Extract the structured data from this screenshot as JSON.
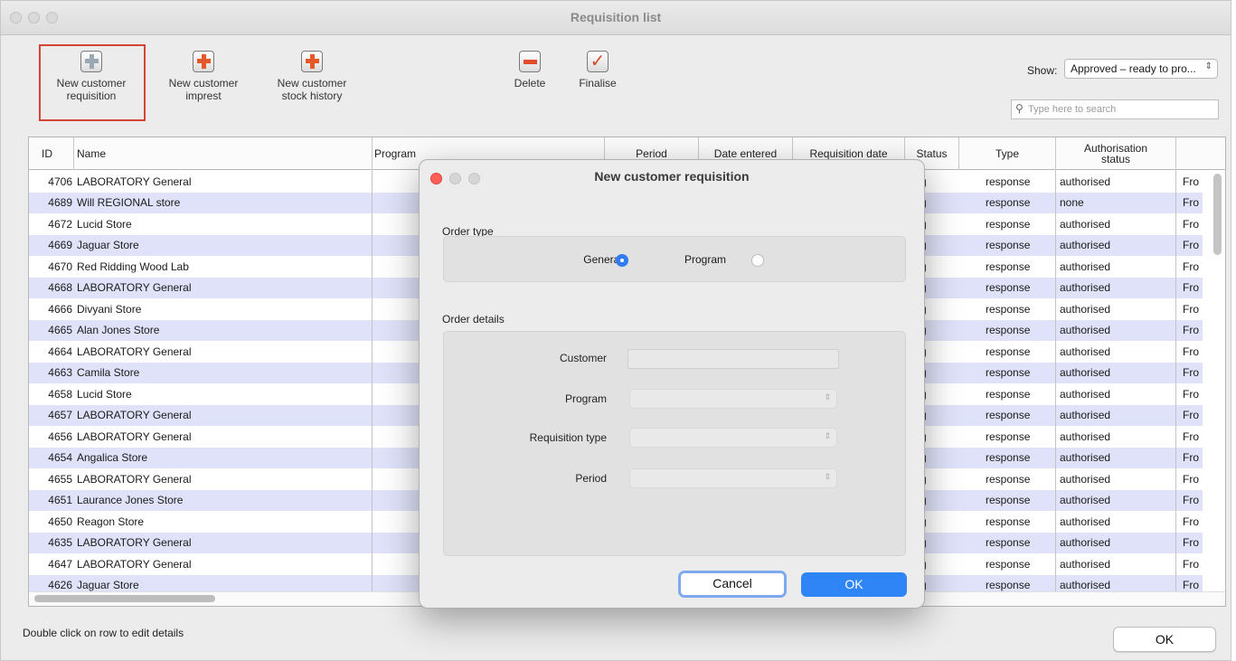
{
  "window": {
    "title": "Requisition list"
  },
  "toolbar": {
    "new_customer_requisition": "New customer\nrequisition",
    "new_customer_imprest": "New customer\nimprest",
    "new_customer_stock_history": "New customer\nstock history",
    "delete": "Delete",
    "finalise": "Finalise",
    "show_label": "Show:",
    "show_value": "Approved – ready to pro...",
    "search_placeholder": "Type here to search"
  },
  "table": {
    "headers": {
      "id": "ID",
      "name": "Name",
      "program": "Program",
      "period": "Period",
      "date_entered": "Date entered",
      "requisition_date": "Requisition date",
      "status": "Status",
      "type": "Type",
      "authorisation_status": "Authorisation\nstatus"
    },
    "rows": [
      {
        "id": "4706",
        "name": "LABORATORY General",
        "status": "sg",
        "type": "response",
        "auth": "authorised",
        "extra": "Fro"
      },
      {
        "id": "4689",
        "name": "Will REGIONAL store",
        "status": "sg",
        "type": "response",
        "auth": "none",
        "extra": "Fro"
      },
      {
        "id": "4672",
        "name": "Lucid Store",
        "status": "sg",
        "type": "response",
        "auth": "authorised",
        "extra": "Fro"
      },
      {
        "id": "4669",
        "name": "Jaguar Store",
        "status": "sg",
        "type": "response",
        "auth": "authorised",
        "extra": "Fro"
      },
      {
        "id": "4670",
        "name": "Red Ridding Wood Lab",
        "status": "sg",
        "type": "response",
        "auth": "authorised",
        "extra": "Fro"
      },
      {
        "id": "4668",
        "name": "LABORATORY General",
        "status": "sg",
        "type": "response",
        "auth": "authorised",
        "extra": "Fro"
      },
      {
        "id": "4666",
        "name": "Divyani Store",
        "status": "sg",
        "type": "response",
        "auth": "authorised",
        "extra": "Fro"
      },
      {
        "id": "4665",
        "name": "Alan Jones Store",
        "status": "sg",
        "type": "response",
        "auth": "authorised",
        "extra": "Fro"
      },
      {
        "id": "4664",
        "name": "LABORATORY General",
        "status": "sg",
        "type": "response",
        "auth": "authorised",
        "extra": "Fro"
      },
      {
        "id": "4663",
        "name": "Camila Store",
        "status": "sg",
        "type": "response",
        "auth": "authorised",
        "extra": "Fro"
      },
      {
        "id": "4658",
        "name": "Lucid Store",
        "status": "sg",
        "type": "response",
        "auth": "authorised",
        "extra": "Fro"
      },
      {
        "id": "4657",
        "name": "LABORATORY General",
        "status": "sg",
        "type": "response",
        "auth": "authorised",
        "extra": "Fro"
      },
      {
        "id": "4656",
        "name": "LABORATORY General",
        "status": "sg",
        "type": "response",
        "auth": "authorised",
        "extra": "Fro"
      },
      {
        "id": "4654",
        "name": "Angalica Store",
        "status": "sg",
        "type": "response",
        "auth": "authorised",
        "extra": "Fro"
      },
      {
        "id": "4655",
        "name": "LABORATORY General",
        "status": "sg",
        "type": "response",
        "auth": "authorised",
        "extra": "Fro"
      },
      {
        "id": "4651",
        "name": "Laurance Jones Store",
        "status": "sg",
        "type": "response",
        "auth": "authorised",
        "extra": "Fro"
      },
      {
        "id": "4650",
        "name": "Reagon Store",
        "status": "sg",
        "type": "response",
        "auth": "authorised",
        "extra": "Fro"
      },
      {
        "id": "4635",
        "name": "LABORATORY General",
        "status": "sg",
        "type": "response",
        "auth": "authorised",
        "extra": "Fro"
      },
      {
        "id": "4647",
        "name": "LABORATORY General",
        "status": "sg",
        "type": "response",
        "auth": "authorised",
        "extra": "Fro"
      },
      {
        "id": "4626",
        "name": "Jaguar Store",
        "status": "sg",
        "type": "response",
        "auth": "authorised",
        "extra": "Fro"
      }
    ]
  },
  "footer": {
    "hint": "Double click on row to edit details",
    "ok": "OK"
  },
  "modal": {
    "title": "New customer requisition",
    "order_type_label": "Order type",
    "general": "General",
    "program": "Program",
    "selected_order_type": "General",
    "order_details_label": "Order details",
    "customer_label": "Customer",
    "program_label": "Program",
    "requisition_type_label": "Requisition type",
    "period_label": "Period",
    "cancel": "Cancel",
    "ok": "OK"
  },
  "colors": {
    "row_alt": "#dfe2f9",
    "accent_blue": "#2f84f6",
    "highlight_red": "#d64434",
    "close_red": "#ff5f57"
  },
  "icons": {
    "search": "magnifier-icon",
    "plus": "plus-icon",
    "minus": "minus-icon",
    "check": "checkmark-icon"
  }
}
